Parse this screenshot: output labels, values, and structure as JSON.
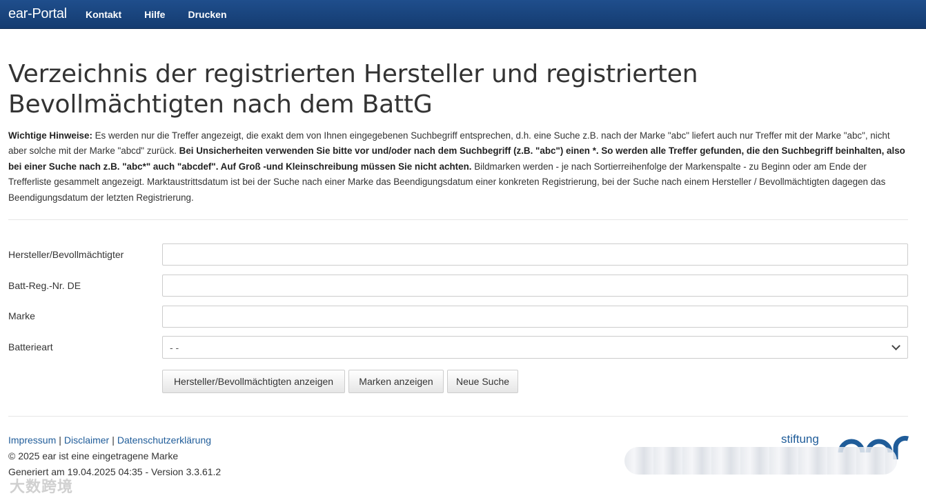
{
  "navbar": {
    "brand": "ear-Portal",
    "links": [
      "Kontakt",
      "Hilfe",
      "Drucken"
    ],
    "color": "#1a4580"
  },
  "page": {
    "title": "Verzeichnis der registrierten Hersteller und registrierten Bevollmächtigten nach dem BattG"
  },
  "notice": {
    "label": "Wichtige Hinweise:",
    "text1": " Es werden nur die Treffer angezeigt, die exakt dem von Ihnen eingegebenen Suchbegriff entsprechen, d.h. eine Suche z.B. nach der Marke \"abc\" liefert auch nur Treffer mit der Marke \"abc\", nicht aber solche mit der Marke \"abcd\" zurück. ",
    "bold_text": "Bei Unsicherheiten verwenden Sie bitte vor und/oder nach dem Suchbegriff (z.B. \"abc\") einen *. So werden alle Treffer gefunden, die den Suchbegriff beinhalten, also bei einer Suche nach z.B. \"abc*\" auch \"abcdef\". Auf Groß -und Kleinschreibung müssen Sie nicht achten.",
    "text2": " Bildmarken werden - je nach Sortierreihenfolge der Markenspalte - zu Beginn oder am Ende der Trefferliste gesammelt angezeigt. Marktaustrittsdatum ist bei der Suche nach einer Marke das Beendigungsdatum einer konkreten Registrierung, bei der Suche nach einem Hersteller / Bevollmächtigten dagegen das Beendigungsdatum der letzten Registrierung."
  },
  "form": {
    "manufacturer_label": "Hersteller/Bevollmächtigter",
    "manufacturer_value": "",
    "regnr_label": "Batt-Reg.-Nr. DE",
    "regnr_value": "",
    "brand_label": "Marke",
    "brand_value": "",
    "batterytype_label": "Batterieart",
    "batterytype_selected": "- -"
  },
  "buttons": {
    "show_manufacturers": "Hersteller/Bevollmächtigten anzeigen",
    "show_brands": "Marken anzeigen",
    "new_search": "Neue Suche"
  },
  "footer": {
    "impressum": "Impressum",
    "disclaimer": "Disclaimer",
    "privacy": "Datenschutzerklärung",
    "separator": "|",
    "trademark": "© 2025 ear ist eine eingetragene Marke",
    "generated": "Generiert am 19.04.2025 04:35 - Version 3.3.61.2",
    "logo_text": "stiftung",
    "link_color": "#1f5c99"
  },
  "watermark": {
    "text": "大数跨境"
  }
}
